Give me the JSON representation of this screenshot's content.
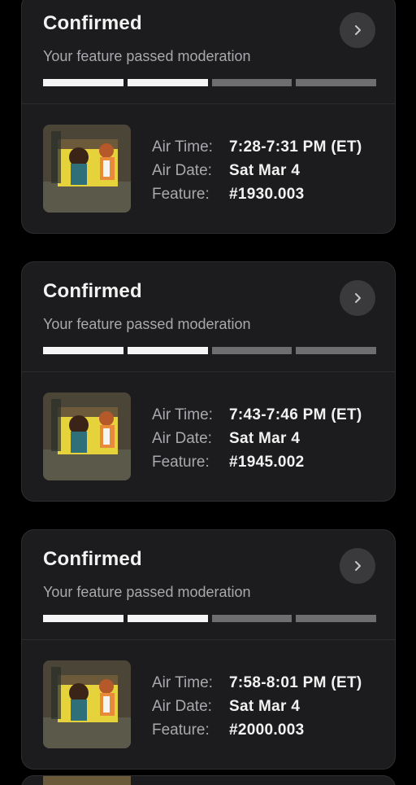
{
  "header": {
    "back_icon": "chevron-left-icon"
  },
  "cards": [
    {
      "status": "Confirmed",
      "message": "Your feature passed moderation",
      "progress_segments": [
        "done",
        "done",
        "pending",
        "pending"
      ],
      "air_time_label": "Air Time:",
      "air_time": "7:28-7:31 PM (ET)",
      "air_date_label": "Air Date:",
      "air_date": "Sat Mar 4",
      "feature_label": "Feature:",
      "feature": "#1930.003"
    },
    {
      "status": "Confirmed",
      "message": "Your feature passed moderation",
      "progress_segments": [
        "done",
        "done",
        "pending",
        "pending"
      ],
      "air_time_label": "Air Time:",
      "air_time": "7:43-7:46 PM (ET)",
      "air_date_label": "Air Date:",
      "air_date": "Sat Mar 4",
      "feature_label": "Feature:",
      "feature": "#1945.002"
    },
    {
      "status": "Confirmed",
      "message": "Your feature passed moderation",
      "progress_segments": [
        "done",
        "done",
        "pending",
        "pending"
      ],
      "air_time_label": "Air Time:",
      "air_time": "7:58-8:01 PM (ET)",
      "air_date_label": "Air Date:",
      "air_date": "Sat Mar 4",
      "feature_label": "Feature:",
      "feature": "#2000.003"
    }
  ],
  "colors": {
    "background": "#000000",
    "card": "#1c1c1e",
    "progress_done": "#f5f5f5",
    "progress_pending": "#6e6e70",
    "muted_text": "#a9a9ad"
  }
}
